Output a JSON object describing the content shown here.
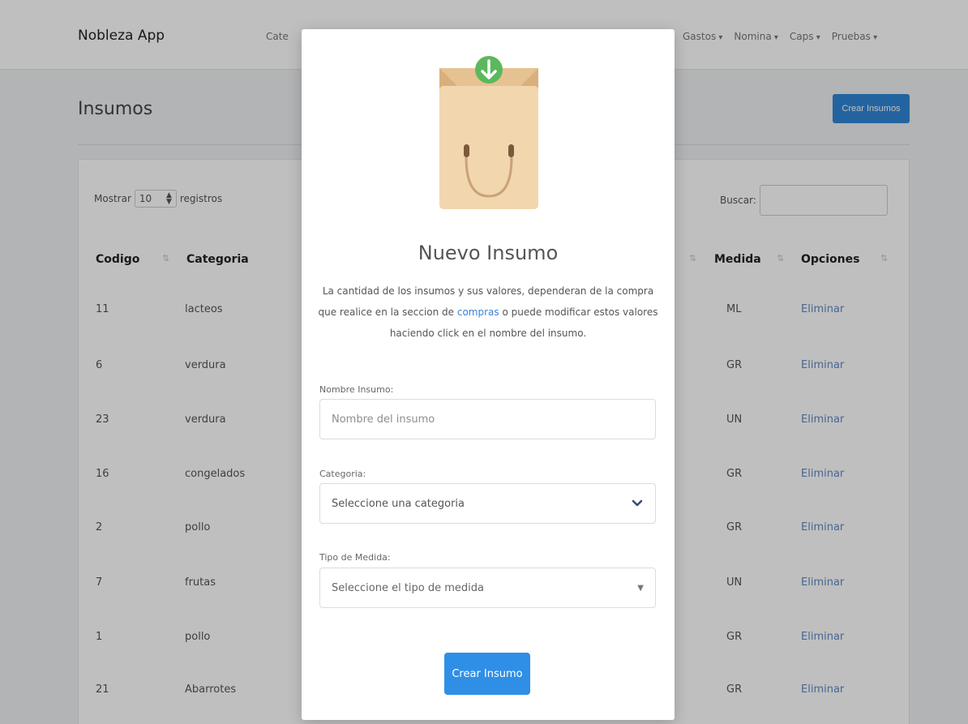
{
  "navbar": {
    "brand": "Nobleza App",
    "partial_item": "Cate",
    "menus": [
      "Gastos",
      "Nomina",
      "Caps",
      "Pruebas"
    ]
  },
  "page": {
    "title": "Insumos",
    "create_button": "Crear Insumos"
  },
  "table_controls": {
    "show_prefix": "Mostrar",
    "show_value": "10",
    "show_suffix": "registros",
    "search_label": "Buscar:"
  },
  "table": {
    "headers": {
      "codigo": "Codigo",
      "categoria": "Categoria",
      "medida": "Medida",
      "opciones": "Opciones"
    },
    "rows": [
      {
        "codigo": "11",
        "categoria": "lacteos",
        "medida": "ML",
        "opcion": "Eliminar"
      },
      {
        "codigo": "6",
        "categoria": "verdura",
        "medida": "GR",
        "opcion": "Eliminar"
      },
      {
        "codigo": "23",
        "categoria": "verdura",
        "medida": "UN",
        "opcion": "Eliminar"
      },
      {
        "codigo": "16",
        "categoria": "congelados",
        "medida": "GR",
        "opcion": "Eliminar"
      },
      {
        "codigo": "2",
        "categoria": "pollo",
        "medida": "GR",
        "opcion": "Eliminar"
      },
      {
        "codigo": "7",
        "categoria": "frutas",
        "medida": "UN",
        "opcion": "Eliminar"
      },
      {
        "codigo": "1",
        "categoria": "pollo",
        "medida": "GR",
        "opcion": "Eliminar"
      },
      {
        "codigo": "21",
        "categoria": "Abarrotes",
        "medida": "GR",
        "opcion": "Eliminar"
      }
    ]
  },
  "modal": {
    "icon": "shopping-bag-download-icon",
    "title": "Nuevo Insumo",
    "desc_part1": "La cantidad de los insumos y sus valores, dependeran de la compra que realice en la seccion de ",
    "desc_link": "compras",
    "desc_part2": " o puede modificar estos valores haciendo click en el nombre del insumo.",
    "name_label": "Nombre Insumo:",
    "name_placeholder": "Nombre del insumo",
    "category_label": "Categoria:",
    "category_value": "Seleccione una categoria",
    "measure_label": "Tipo de Medida:",
    "measure_value": "Seleccione el tipo de medida",
    "submit": "Crear Insumo"
  },
  "colors": {
    "primary": "#2f8fe6",
    "link": "#3a83d6",
    "bag": "#f2d6ad",
    "badge": "#5cb85c"
  }
}
